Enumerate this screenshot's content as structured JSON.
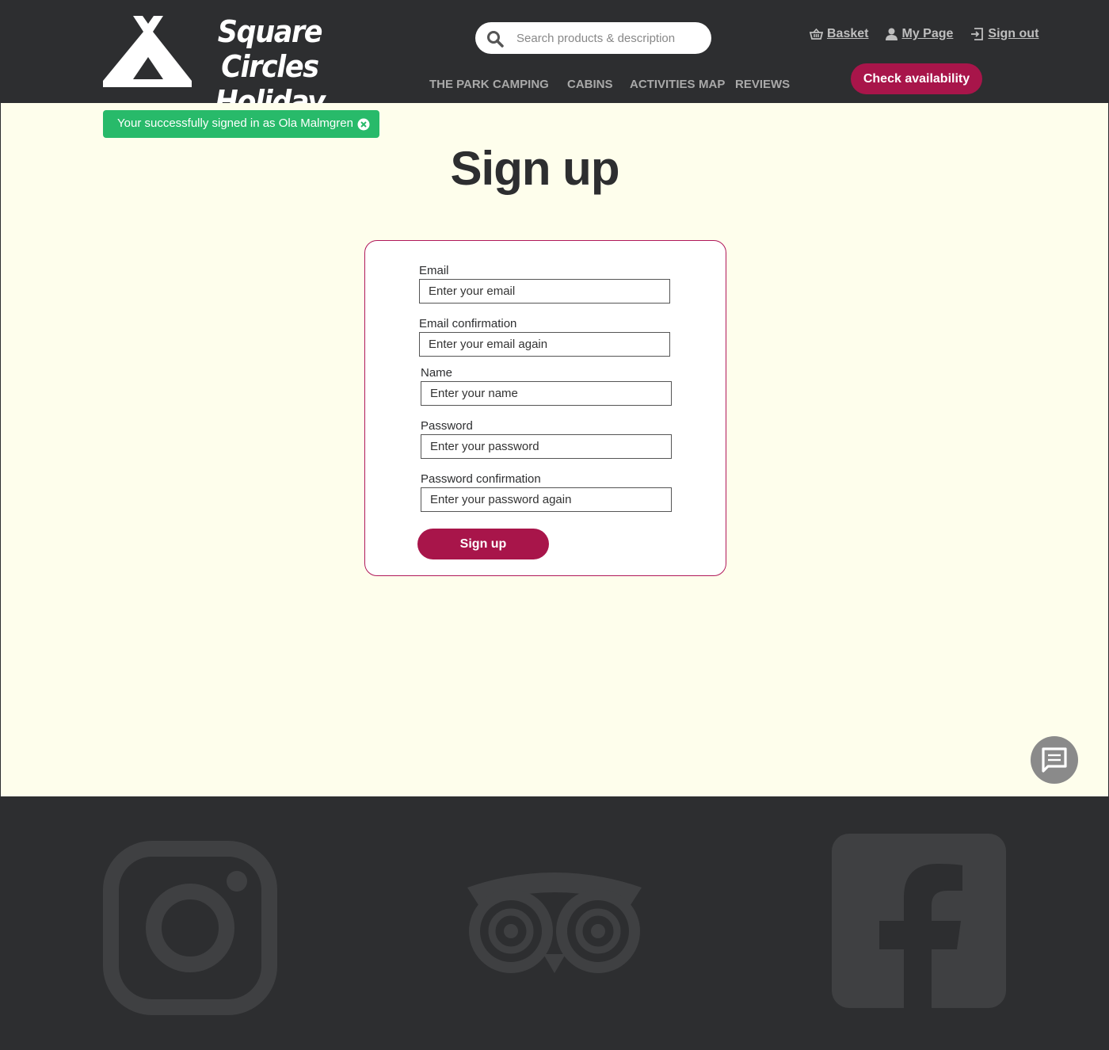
{
  "header": {
    "logo": {
      "line1": "Square Circles",
      "line2": "Holiday Park",
      "icon": "tent-icon"
    },
    "search": {
      "placeholder": "Search products & description",
      "icon": "search-icon"
    },
    "links": [
      {
        "label": "Basket",
        "icon": "basket-icon"
      },
      {
        "label": "My Page",
        "icon": "user-icon"
      },
      {
        "label": "Sign out",
        "icon": "sign-out-icon"
      }
    ],
    "nav": [
      "THE PARK",
      "CAMPING",
      "CABINS",
      "ACTIVITIES",
      "MAP",
      "REVIEWS"
    ],
    "cta_label": "Check availability"
  },
  "toast": {
    "message": "Your successfully signed in as Ola Malmgren",
    "close_icon": "close-circle-icon"
  },
  "page_title": "Sign up",
  "form": {
    "fields": [
      {
        "label": "Email",
        "placeholder": "Enter your email",
        "value": ""
      },
      {
        "label": "Email confirmation",
        "placeholder": "Enter your email again",
        "value": ""
      },
      {
        "label": "Name",
        "placeholder": "Enter your name",
        "value": ""
      },
      {
        "label": "Password",
        "placeholder": "Enter your password",
        "value": ""
      },
      {
        "label": "Password confirmation",
        "placeholder": "Enter your password again",
        "value": ""
      }
    ],
    "submit_label": "Sign up"
  },
  "chat": {
    "icon": "chat-icon"
  },
  "footer": {
    "social": [
      "instagram-icon",
      "tripadvisor-icon",
      "facebook-icon"
    ]
  },
  "colors": {
    "dark": "#2d2e30",
    "accent": "#a8154a",
    "page_bg": "#fefeec",
    "toast_bg": "#28ba6a",
    "footer_icon": "#3f4042"
  }
}
